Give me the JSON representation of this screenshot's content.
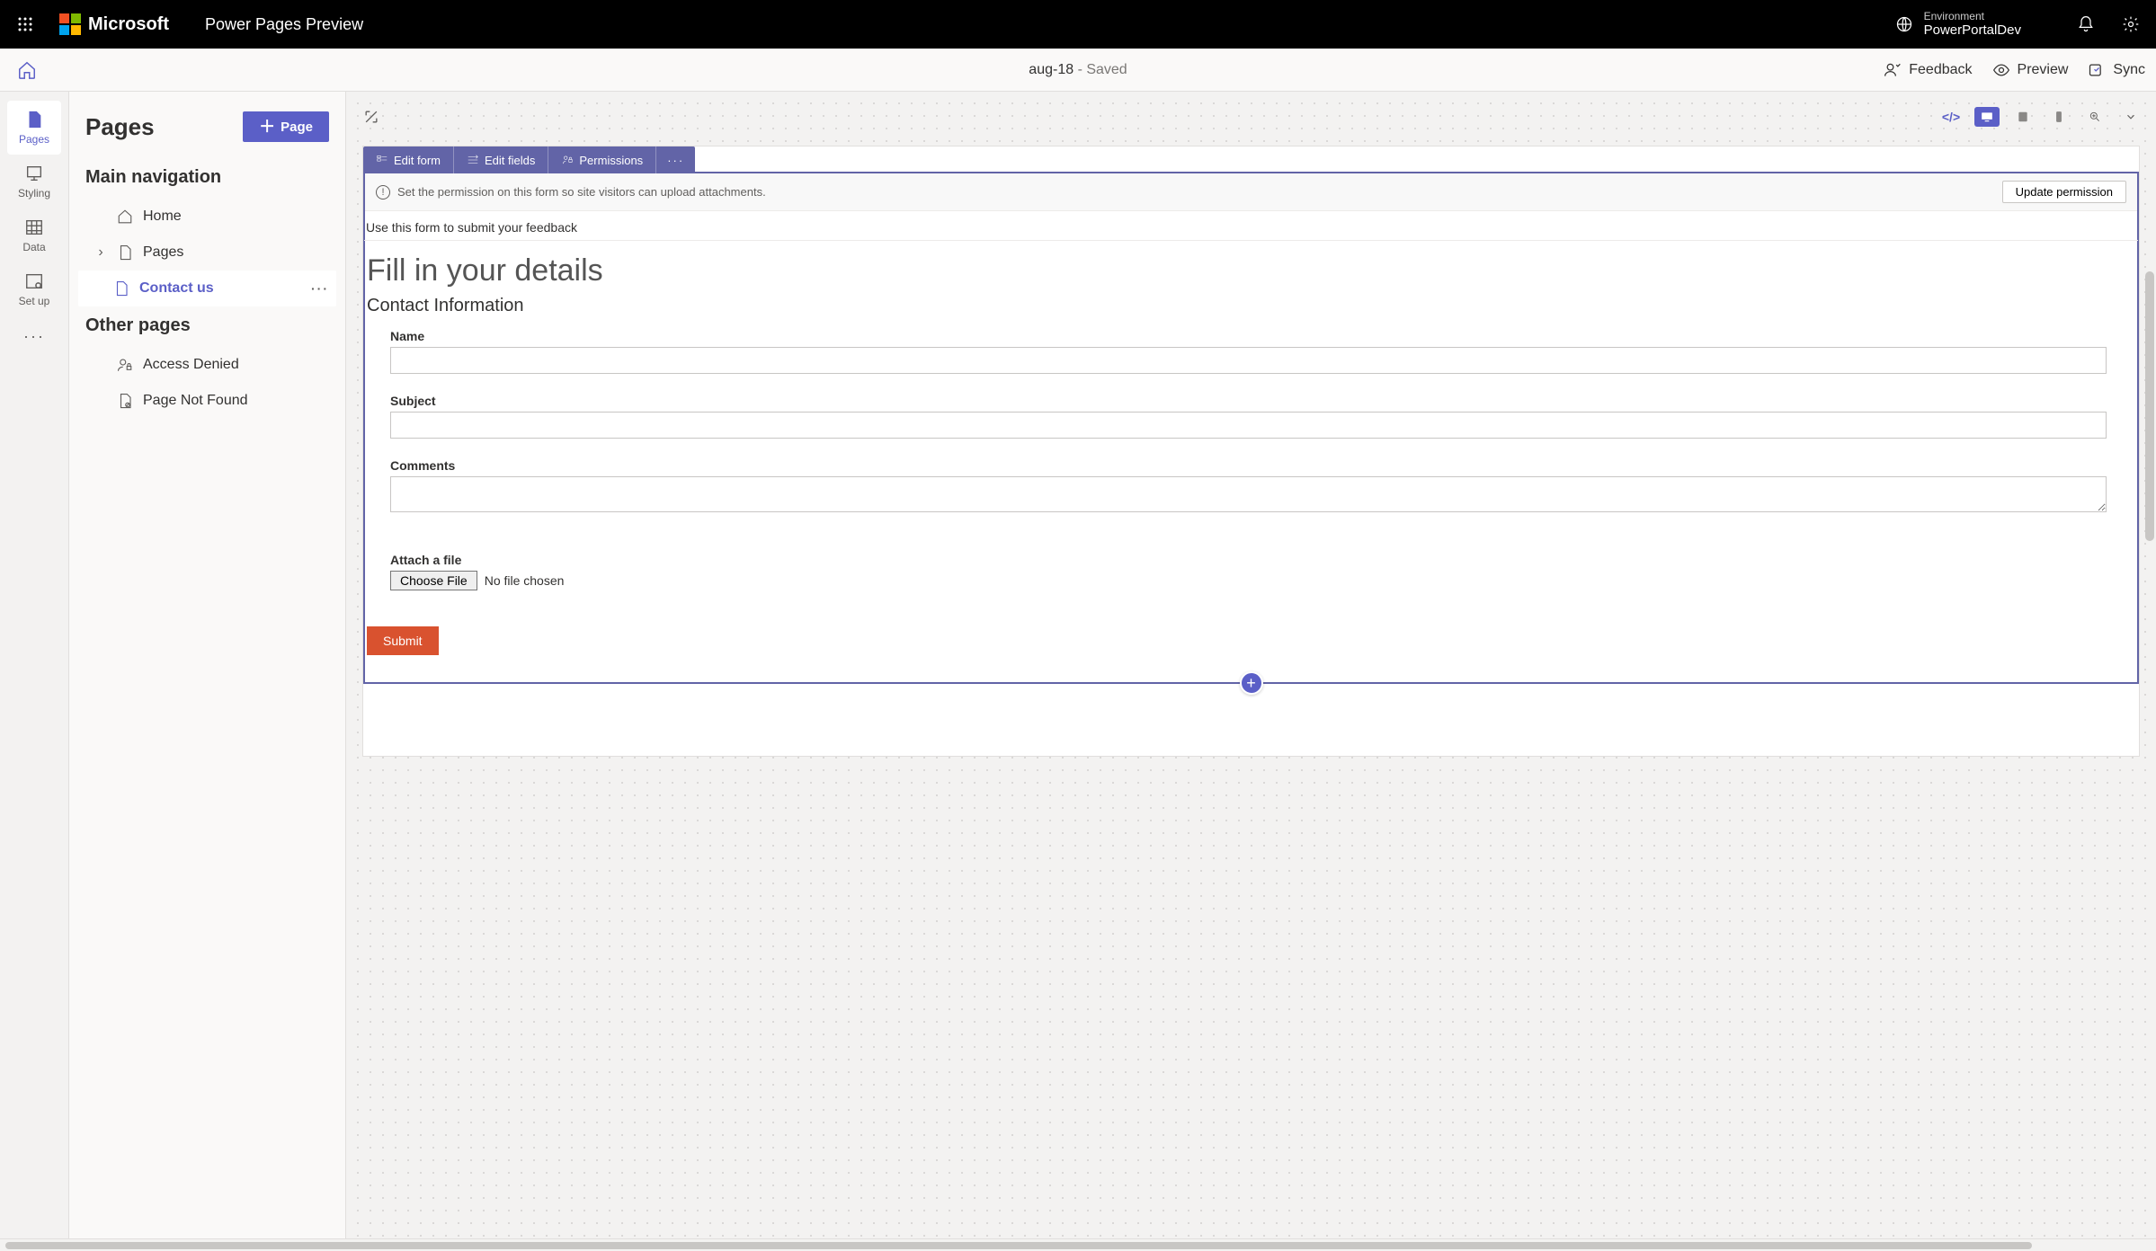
{
  "topbar": {
    "ms_text": "Microsoft",
    "app_title": "Power Pages Preview",
    "env_label": "Environment",
    "env_name": "PowerPortalDev"
  },
  "cmdbar": {
    "doc_name": "aug-18",
    "status": " - Saved",
    "feedback": "Feedback",
    "preview": "Preview",
    "sync": "Sync"
  },
  "rail": {
    "pages": "Pages",
    "styling": "Styling",
    "data": "Data",
    "setup": "Set up"
  },
  "panel": {
    "title": "Pages",
    "new_page_btn": "Page",
    "main_nav": "Main navigation",
    "other_pages": "Other pages",
    "items": {
      "home": "Home",
      "pages": "Pages",
      "contact": "Contact us",
      "access_denied": "Access Denied",
      "not_found": "Page Not Found"
    }
  },
  "form_toolbar": {
    "edit_form": "Edit form",
    "edit_fields": "Edit fields",
    "permissions": "Permissions"
  },
  "perm_bar": {
    "message": "Set the permission on this form so site visitors can upload attachments.",
    "button": "Update permission"
  },
  "form": {
    "description": "Use this form to submit your feedback",
    "heading": "Fill in your details",
    "section": "Contact Information",
    "fields": {
      "name": "Name",
      "subject": "Subject",
      "comments": "Comments",
      "attach": "Attach a file",
      "choose_file": "Choose File",
      "no_file": "No file chosen"
    },
    "submit": "Submit"
  }
}
